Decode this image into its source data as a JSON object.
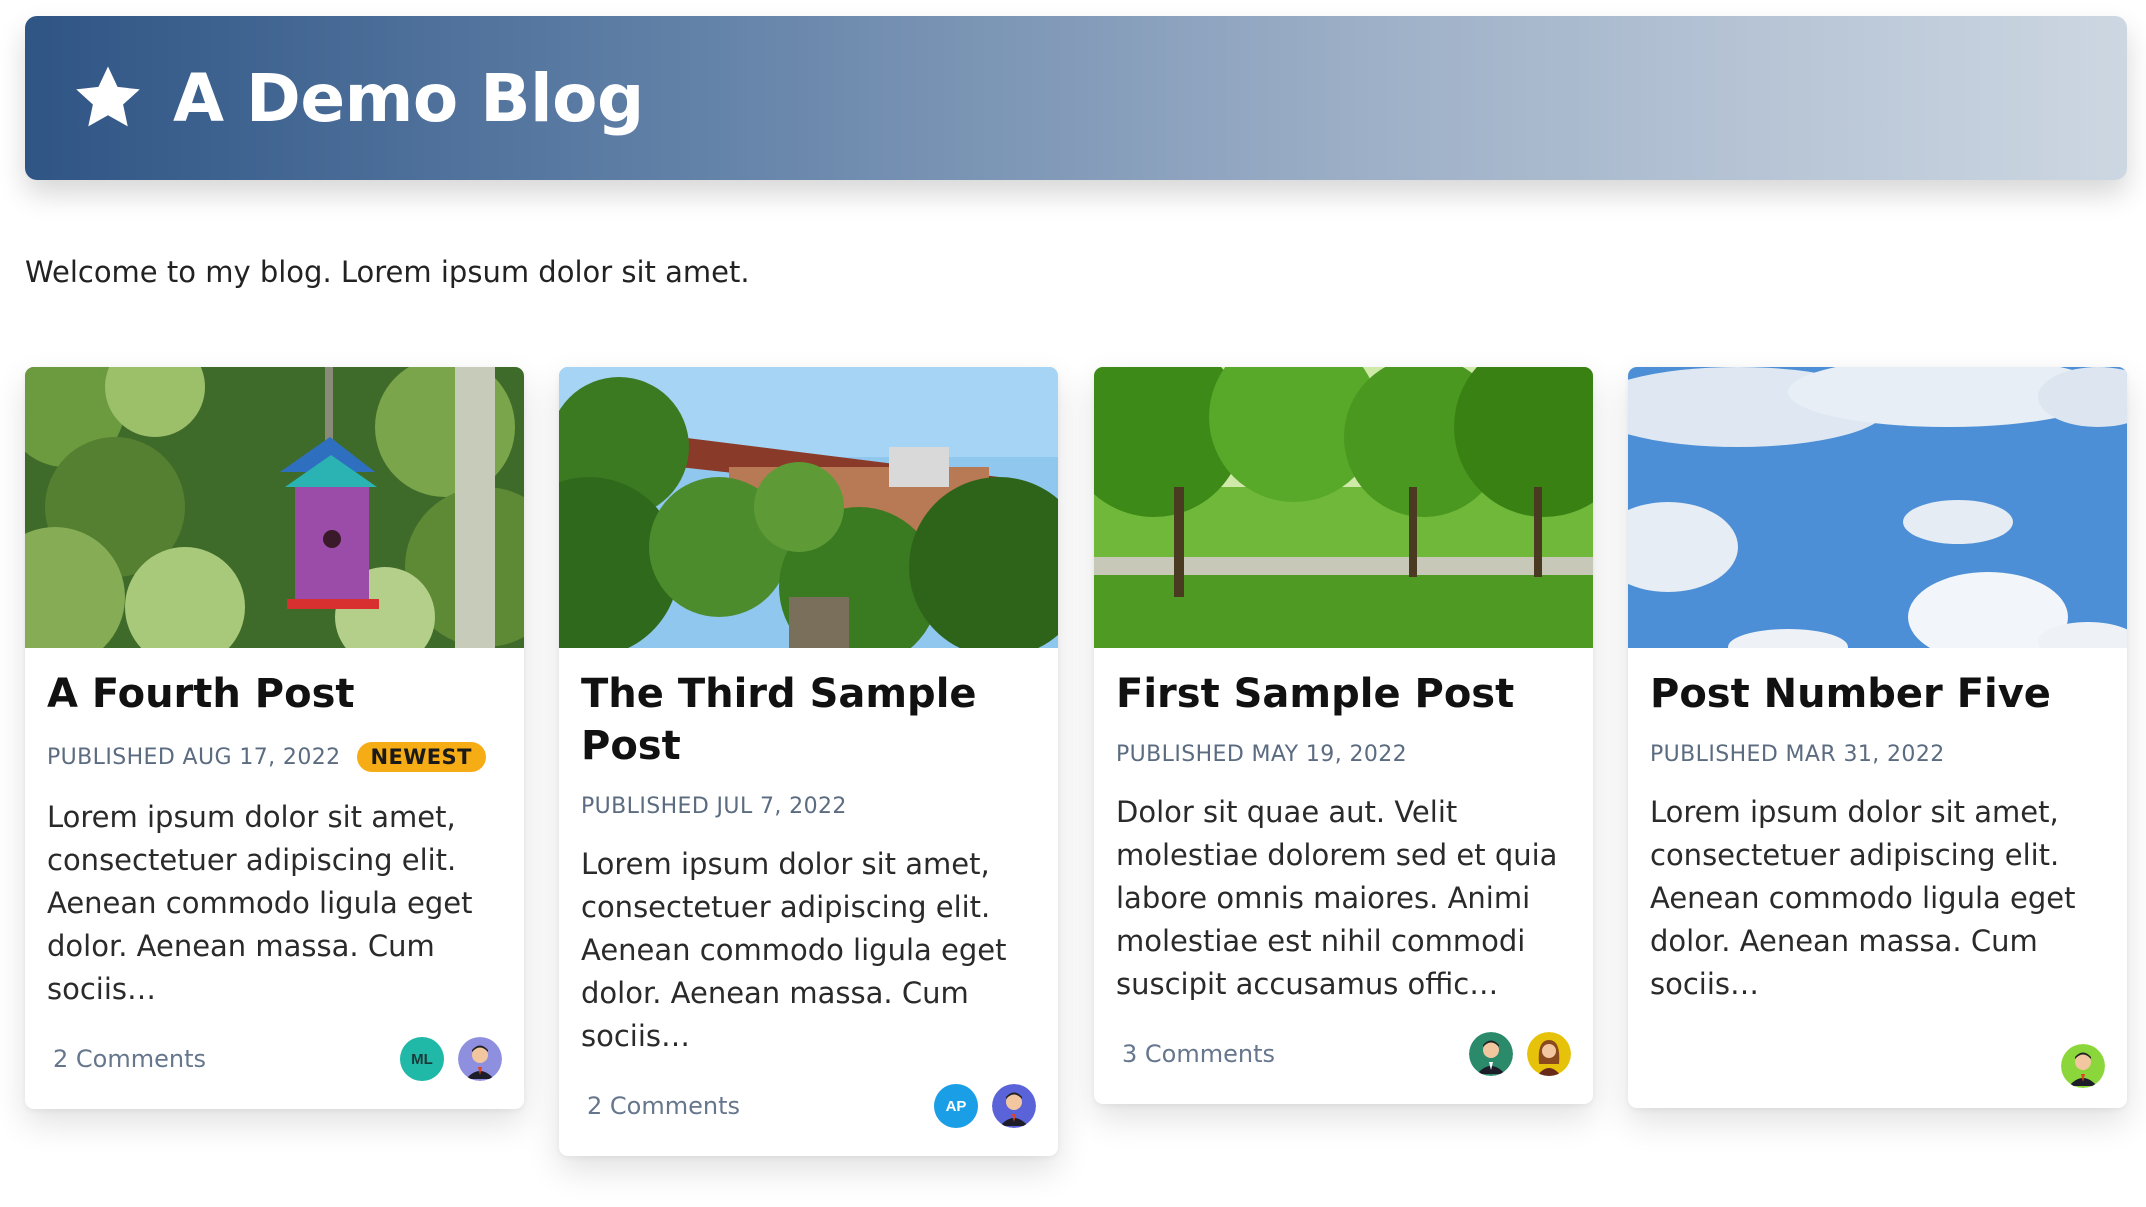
{
  "header": {
    "title": "A Demo Blog",
    "icon": "star-icon"
  },
  "intro": "Welcome to my blog. Lorem ipsum dolor sit amet.",
  "posts": [
    {
      "title": "A Fourth Post",
      "published": "PUBLISHED AUG 17, 2022",
      "badge": "NEWEST",
      "excerpt": "Lorem ipsum dolor sit amet, consectetuer adipiscing elit. Aenean commodo ligula eget dolor. Aenean massa. Cum sociis…",
      "comments": "2 Comments",
      "image": "birdhouse-in-tree",
      "avatars": [
        {
          "initials": "ML",
          "color": "#20b8a6"
        },
        {
          "type": "person",
          "color": "#8f8fe0"
        }
      ]
    },
    {
      "title": "The Third Sample Post",
      "published": "PUBLISHED JUL 7, 2022",
      "excerpt": "Lorem ipsum dolor sit amet, consectetuer adipiscing elit. Aenean commodo ligula eget dolor. Aenean massa. Cum sociis…",
      "comments": "2 Comments",
      "image": "building-among-trees",
      "avatars": [
        {
          "initials": "AP",
          "color": "#1a9ee6"
        },
        {
          "type": "person",
          "color": "#5a63d8"
        }
      ]
    },
    {
      "title": "First Sample Post",
      "published": "PUBLISHED MAY 19, 2022",
      "excerpt": "Dolor sit quae aut. Velit molestiae dolorem sed et quia labore omnis maiores. Animi molestiae est nihil commodi suscipit accusamus offic…",
      "comments": "3 Comments",
      "image": "park-with-trees",
      "avatars": [
        {
          "type": "person",
          "color": "#2a8a6a"
        },
        {
          "type": "person-female",
          "color": "#e6c20a"
        }
      ]
    },
    {
      "title": "Post Number Five",
      "published": "PUBLISHED MAR 31, 2022",
      "excerpt": "Lorem ipsum dolor sit amet, consectetuer adipiscing elit. Aenean commodo ligula eget dolor. Aenean massa. Cum sociis…",
      "comments": "",
      "image": "blue-sky-clouds",
      "avatars": [
        {
          "type": "person",
          "color": "#8bd63a"
        }
      ]
    }
  ]
}
